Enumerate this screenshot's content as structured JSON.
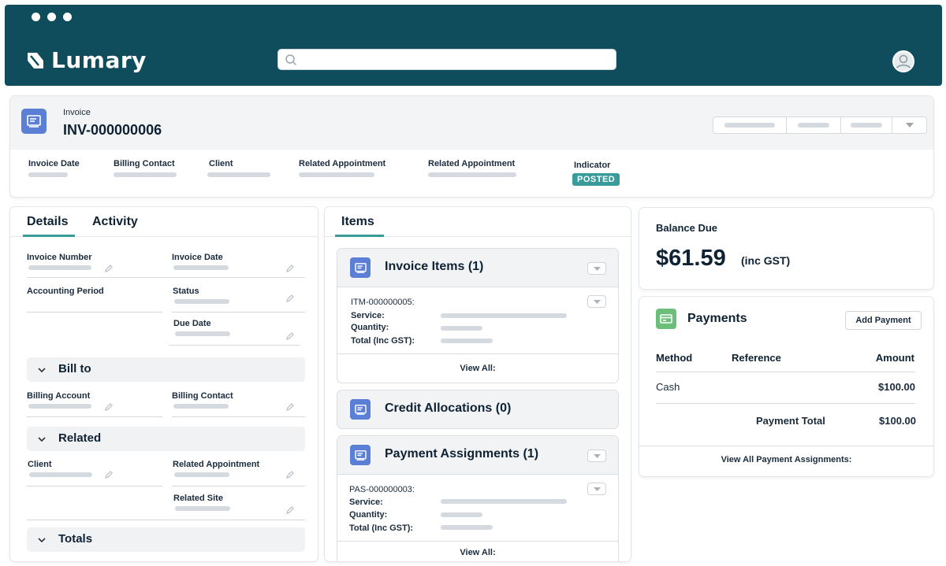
{
  "app": {
    "brand": "Lumary"
  },
  "header": {
    "record_type": "Invoice",
    "record_id": "INV-000000006",
    "fields": {
      "invoice_date": "Invoice Date",
      "billing_contact": "Billing Contact",
      "client": "Client",
      "related_appointment_1": "Related Appointment",
      "related_appointment_2": "Related Appointment",
      "indicator": "Indicator"
    },
    "indicator_badge": "POSTED"
  },
  "details": {
    "tabs": [
      "Details",
      "Activity"
    ],
    "invoice_number": "Invoice Number",
    "invoice_date": "Invoice Date",
    "accounting_period": "Accounting Period",
    "status": "Status",
    "due_date": "Due Date",
    "bill_to": "Bill to",
    "billing_account": "Billing Account",
    "billing_contact": "Billing Contact",
    "related": "Related",
    "client": "Client",
    "related_appointment": "Related Appointment",
    "related_site": "Related Site",
    "totals": "Totals"
  },
  "items": {
    "tab": "Items",
    "invoice_items": {
      "title": "Invoice Items (1)",
      "id": "ITM-000000005:",
      "service": "Service:",
      "quantity": "Quantity:",
      "total": "Total (Inc GST):",
      "view_all": "View All:"
    },
    "credit_allocations": {
      "title": "Credit Allocations (0)"
    },
    "payment_assignments": {
      "title": "Payment Assignments (1)",
      "id": "PAS-000000003:",
      "service": "Service:",
      "quantity": "Quantity:",
      "total": "Total (Inc GST):",
      "view_all": "View All:"
    }
  },
  "balance": {
    "label": "Balance Due",
    "amount": "$61.59",
    "suffix": "(inc GST)"
  },
  "payments": {
    "title": "Payments",
    "add_button": "Add Payment",
    "columns": [
      "Method",
      "Reference",
      "Amount"
    ],
    "rows": [
      {
        "method": "Cash",
        "reference": "",
        "amount": "$100.00"
      }
    ],
    "total_label": "Payment Total",
    "total_value": "$100.00",
    "view_all": "View All Payment Assignments:"
  },
  "colors": {
    "topbar": "#0f4c5c",
    "accent": "#3a9b9b",
    "icon_blue": "#5b7fd4",
    "icon_green": "#6cbf7a"
  }
}
